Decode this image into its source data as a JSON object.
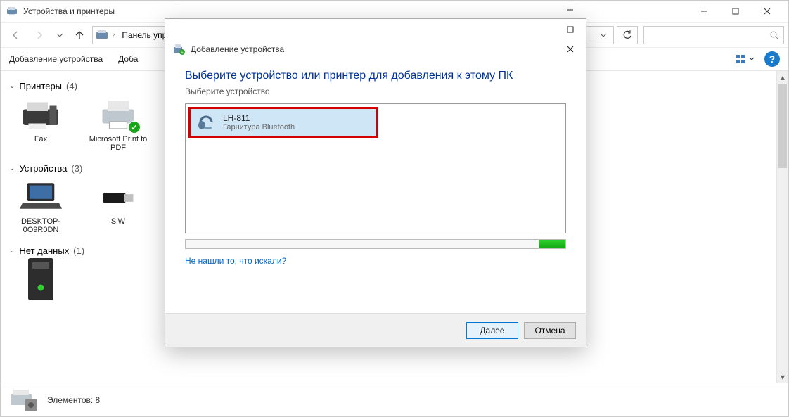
{
  "parent": {
    "title": "Устройства и принтеры",
    "breadcrumb": {
      "item1": "Панель упр"
    },
    "commands": {
      "add_device": "Добавление устройства",
      "add_printer_prefix": "Доба"
    },
    "groups": {
      "printers": {
        "label": "Принтеры",
        "count": "(4)"
      },
      "devices": {
        "label": "Устройства",
        "count": "(3)"
      },
      "nodata": {
        "label": "Нет данных",
        "count": "(1)"
      }
    },
    "items": {
      "fax": "Fax",
      "mpdf": "Microsoft Print to PDF",
      "desktop": "DESKTOP-0O9R0DN",
      "siw": "SiW"
    },
    "status": {
      "elements_label": "Элементов:",
      "elements_count": "8"
    }
  },
  "dialog": {
    "title": "Добавление устройства",
    "instruction": "Выберите устройство или принтер для добавления к этому ПК",
    "sub": "Выберите устройство",
    "device": {
      "name": "LH-811",
      "type": "Гарнитура Bluetooth"
    },
    "help_link": "Не нашли то, что искали?",
    "next": "Далее",
    "cancel": "Отмена"
  }
}
